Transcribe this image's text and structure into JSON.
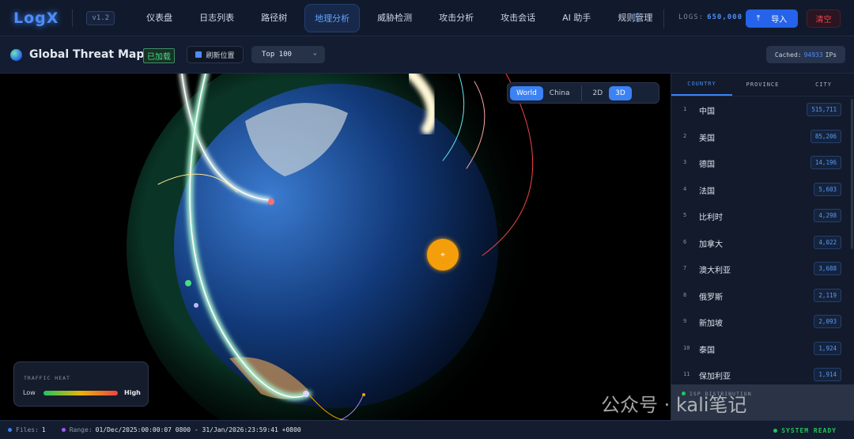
{
  "topbar": {
    "logo": "LogX",
    "version": "v1.2",
    "nav": [
      "仪表盘",
      "日志列表",
      "路径树",
      "地理分析",
      "威胁检测",
      "攻击分析",
      "攻击会话",
      "AI 助手",
      "规则管理"
    ],
    "active_nav": "地理分析",
    "logs_label": "LOGS:",
    "logs_value": "650,000",
    "import_label": "导入",
    "clear_label": "清空"
  },
  "subbar": {
    "title": "Global Threat Map",
    "loaded_badge": "已加载",
    "refresh_label": "刷新位置",
    "top_select": "Top 100",
    "cached_label": "Cached:",
    "cached_value": "94933",
    "cached_unit": "IPs"
  },
  "map": {
    "view_options": [
      "World",
      "China"
    ],
    "dim_options": [
      "2D",
      "3D"
    ],
    "active_view": "World",
    "active_dim": "3D",
    "legend": {
      "title": "TRAFFIC HEAT",
      "low": "Low",
      "high": "High"
    },
    "marker_icon": "location-pin"
  },
  "side": {
    "tabs": [
      "COUNTRY",
      "PROVINCE",
      "CITY"
    ],
    "active_tab": "COUNTRY",
    "rows": [
      {
        "rank": "1",
        "name": "中国",
        "value": "515,711"
      },
      {
        "rank": "2",
        "name": "美国",
        "value": "85,206"
      },
      {
        "rank": "3",
        "name": "德国",
        "value": "14,196"
      },
      {
        "rank": "4",
        "name": "法国",
        "value": "5,603"
      },
      {
        "rank": "5",
        "name": "比利时",
        "value": "4,298"
      },
      {
        "rank": "6",
        "name": "加拿大",
        "value": "4,022"
      },
      {
        "rank": "7",
        "name": "澳大利亚",
        "value": "3,688"
      },
      {
        "rank": "8",
        "name": "俄罗斯",
        "value": "2,119"
      },
      {
        "rank": "9",
        "name": "新加坡",
        "value": "2,093"
      },
      {
        "rank": "10",
        "name": "泰国",
        "value": "1,924"
      },
      {
        "rank": "11",
        "name": "保加利亚",
        "value": "1,914"
      }
    ],
    "isp_label": "ISP DISTRIBUTION"
  },
  "status": {
    "files_label": "Files:",
    "files_value": "1",
    "range_label": "Range:",
    "range_value": "01/Dec/2025:00:00:07 0800 - 31/Jan/2026:23:59:41 +0800",
    "ready": "SYSTEM READY"
  },
  "watermark": "公众号 · kali笔记",
  "colors": {
    "accent": "#3b82f6",
    "danger": "#ef4444",
    "success": "#22c55e",
    "marker": "#f59e0b"
  }
}
